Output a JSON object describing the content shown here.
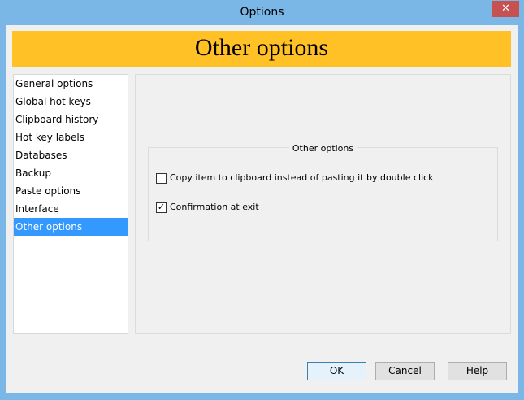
{
  "window": {
    "title": "Options",
    "close_label": "✕"
  },
  "banner": {
    "title": "Other options"
  },
  "nav": {
    "items": [
      {
        "label": "General options"
      },
      {
        "label": "Global hot keys"
      },
      {
        "label": "Clipboard history"
      },
      {
        "label": "Hot key labels"
      },
      {
        "label": "Databases"
      },
      {
        "label": "Backup"
      },
      {
        "label": "Paste options"
      },
      {
        "label": "Interface"
      },
      {
        "label": "Other options"
      }
    ],
    "selected": "Other options"
  },
  "group": {
    "title": "Other options",
    "options": [
      {
        "label": "Copy item to clipboard instead of pasting it by double click",
        "checked": false
      },
      {
        "label": "Confirmation at exit",
        "checked": true
      }
    ]
  },
  "buttons": {
    "ok": "OK",
    "cancel": "Cancel",
    "help": "Help"
  },
  "colors": {
    "titlebar": "#7ab6e6",
    "banner": "#ffc125",
    "selection": "#3399ff",
    "close": "#c75050"
  }
}
